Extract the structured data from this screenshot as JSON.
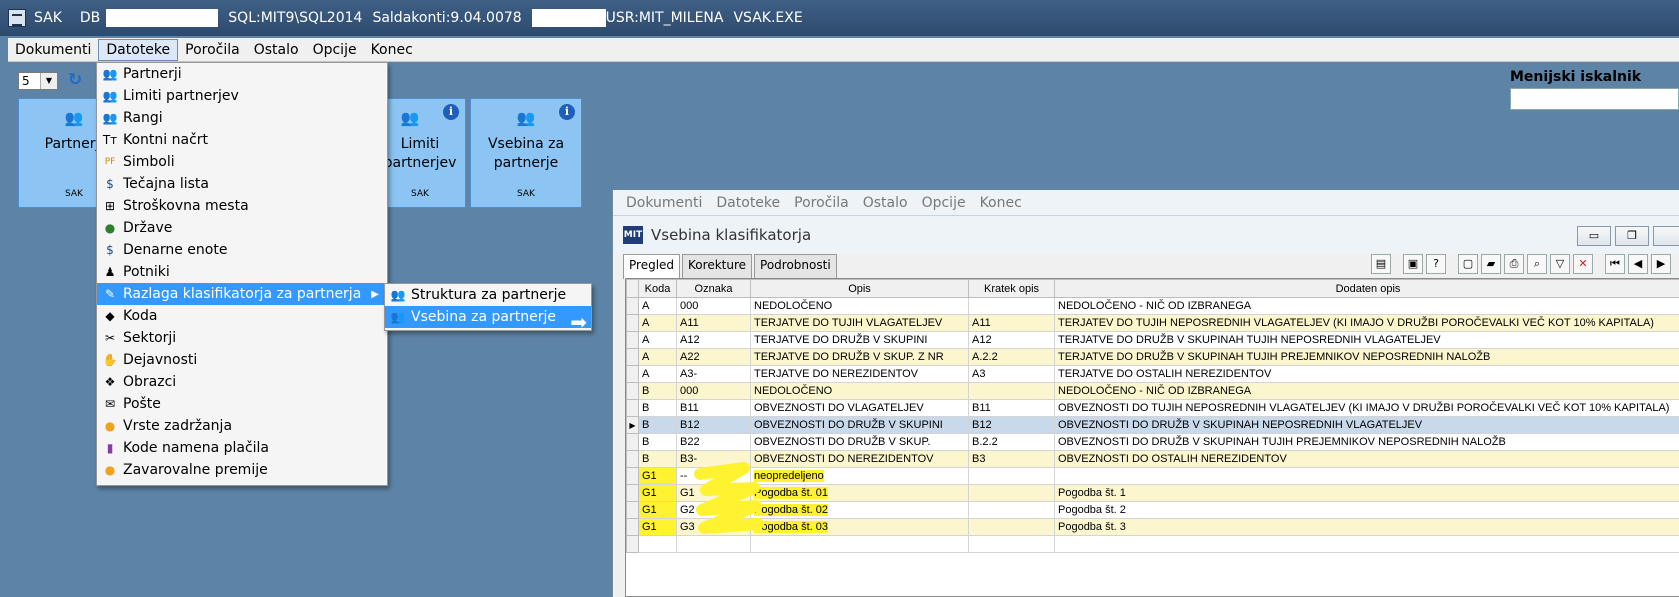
{
  "window": {
    "app_name": "SAK",
    "db_label": "DB",
    "server": "SQL:MIT9\\SQL2014",
    "saldakonti": "Saldakonti:9.04.0078",
    "user": "USR:MIT_MILENA",
    "exe": "VSAK.EXE"
  },
  "menubar": {
    "items": [
      "Dokumenti",
      "Datoteke",
      "Poročila",
      "Ostalo",
      "Opcije",
      "Konec"
    ]
  },
  "toolbar": {
    "combo_value": "5"
  },
  "tiles": [
    {
      "label": "Partnerji",
      "footer": "SAK"
    },
    {
      "label": "Limiti partnerjev",
      "footer": "SAK"
    },
    {
      "label": "Vsebina za partnerje",
      "footer": "SAK"
    }
  ],
  "search": {
    "label": "Menijski iskalnik",
    "value": ""
  },
  "dropdown": {
    "items": [
      {
        "label": "Partnerji",
        "icon": "partners-icon"
      },
      {
        "label": "Limiti partnerjev",
        "icon": "partners-icon"
      },
      {
        "label": "Rangi",
        "icon": "partners-icon"
      },
      {
        "label": "Kontni načrt",
        "icon": "text-icon"
      },
      {
        "label": "Simboli",
        "icon": "pf-icon"
      },
      {
        "label": "Tečajna lista",
        "icon": "dollar-icon"
      },
      {
        "label": "Stroškovna mesta",
        "icon": "tree-icon"
      },
      {
        "label": "Države",
        "icon": "globe-icon"
      },
      {
        "label": "Denarne enote",
        "icon": "dollar-icon"
      },
      {
        "label": "Potniki",
        "icon": "person-icon"
      },
      {
        "label": "Razlaga klasifikatorja za partnerja",
        "icon": "pencil-icon"
      },
      {
        "label": "Koda",
        "icon": "code-icon"
      },
      {
        "label": "Sektorji",
        "icon": "tools-icon"
      },
      {
        "label": "Dejavnosti",
        "icon": "hand-icon"
      },
      {
        "label": "Obrazci",
        "icon": "forms-icon"
      },
      {
        "label": "Pošte",
        "icon": "post-icon"
      },
      {
        "label": "Vrste zadržanja",
        "icon": "bubble-icon"
      },
      {
        "label": "Kode namena plačila",
        "icon": "barcode-icon"
      },
      {
        "label": "Zavarovalne premije",
        "icon": "bubble-icon"
      }
    ]
  },
  "submenu": {
    "items": [
      {
        "label": "Struktura za partnerje"
      },
      {
        "label": "Vsebina za partnerje"
      }
    ]
  },
  "child": {
    "menu": [
      "Dokumenti",
      "Datoteke",
      "Poročila",
      "Ostalo",
      "Opcije",
      "Konec"
    ],
    "title": "Vsebina klasifikatorja",
    "logo": "MIT",
    "tabs": [
      "Pregled",
      "Korekture",
      "Podrobnosti"
    ],
    "columns": [
      "Koda",
      "Oznaka",
      "Opis",
      "Kratek opis",
      "Dodaten opis"
    ],
    "rows": [
      [
        "A",
        "000",
        "NEDOLOČENO",
        "",
        "NEDOLOČENO - NIČ OD IZBRANEGA"
      ],
      [
        "A",
        "A11",
        "TERJATVE DO TUJIH VLAGATELJEV",
        "A11",
        "TERJATEV DO TUJIH NEPOSREDNIH VLAGATELJEV (KI IMAJO V DRUŽBI POROČEVALKI VEČ KOT 10% KAPITALA)"
      ],
      [
        "A",
        "A12",
        "TERJATVE DO DRUŽB V SKUPINI",
        "A12",
        "TERJATVE DO DRUŽB V SKUPINAH TUJIH NEPOSREDNIH VLAGATELJEV"
      ],
      [
        "A",
        "A22",
        "TERJATVE DO DRUŽB V SKUP. Z NR",
        "A.2.2",
        "TERJATVE DO DRUŽB V SKUPINAH TUJIH PREJEMNIKOV NEPOSREDNIH NALOŽB"
      ],
      [
        "A",
        "A3-",
        "TERJATVE DO NEREZIDENTOV",
        "A3",
        "TERJATVE DO OSTALIH NEREZIDENTOV"
      ],
      [
        "B",
        "000",
        "NEDOLOČENO",
        "",
        "NEDOLOČENO - NIČ OD IZBRANEGA"
      ],
      [
        "B",
        "B11",
        "OBVEZNOSTI DO  VLAGATELJEV",
        "B11",
        "OBVEZNOSTI DO TUJIH NEPOSREDNIH VLAGATELJEV (KI IMAJO V DRUŽBI POROČEVALKI VEČ KOT 10% KAPITALA)"
      ],
      [
        "B",
        "B12",
        "OBVEZNOSTI DO DRUŽB V SKUPINI",
        "B12",
        "OBVEZNOSTI DO DRUŽB V SKUPINAH NEPOSREDNIH VLAGATELJEV"
      ],
      [
        "B",
        "B22",
        "OBVEZNOSTI DO DRUŽB V SKUP.",
        "B.2.2",
        "OBVEZNOSTI DO DRUŽB V SKUPINAH TUJIH PREJEMNIKOV NEPOSREDNIH NALOŽB"
      ],
      [
        "B",
        "B3-",
        "OBVEZNOSTI DO NEREZIDENTOV",
        "B3",
        "OBVEZNOSTI DO OSTALIH NEREZIDENTOV"
      ],
      [
        "G1",
        "--",
        "neopredeljeno",
        "",
        ""
      ],
      [
        "G1",
        "G1",
        "Pogodba št. 01",
        "",
        "Pogodba št. 1"
      ],
      [
        "G1",
        "G2",
        "Pogodba št. 02",
        "",
        "Pogodba št. 2"
      ],
      [
        "G1",
        "G3",
        "Pogodba št. 03",
        "",
        "Pogodba št. 3"
      ],
      [
        "",
        "",
        "",
        "",
        ""
      ]
    ],
    "selected_row": 7
  },
  "colors": {
    "desktop": "#5d84a6",
    "tile": "#8cc4f3",
    "highlight": "#3399ff",
    "marker": "#fff230"
  }
}
